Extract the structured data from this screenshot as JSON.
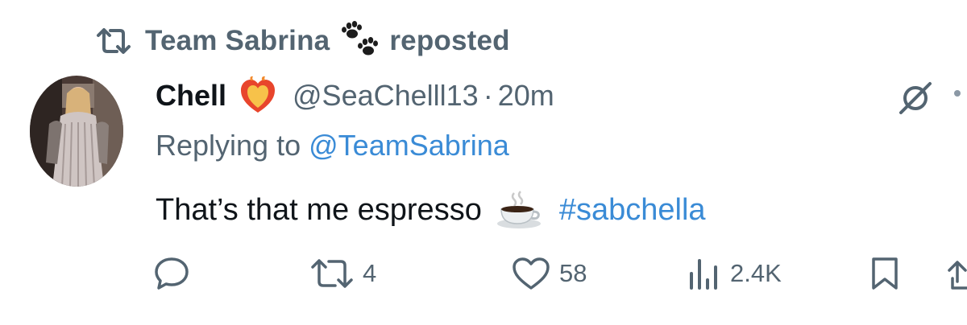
{
  "repost_banner": {
    "user": "Team Sabrina",
    "suffix": "reposted",
    "icon": "repost-icon",
    "emoji": "paw-prints"
  },
  "tweet": {
    "author_name": "Chell",
    "author_emoji": "heart-on-fire",
    "handle": "@SeaChelll13",
    "separator": "·",
    "time": "20m",
    "replying_prefix": "Replying to",
    "replying_to": "@TeamSabrina",
    "text": "That’s that me espresso",
    "text_emoji": "hot-beverage",
    "hashtag": "#sabchella"
  },
  "actions": {
    "replies": "",
    "reposts": "4",
    "likes": "58",
    "views": "2.4K"
  },
  "colors": {
    "link": "#3a8bd6",
    "muted": "#536471",
    "text": "#0f1419"
  }
}
